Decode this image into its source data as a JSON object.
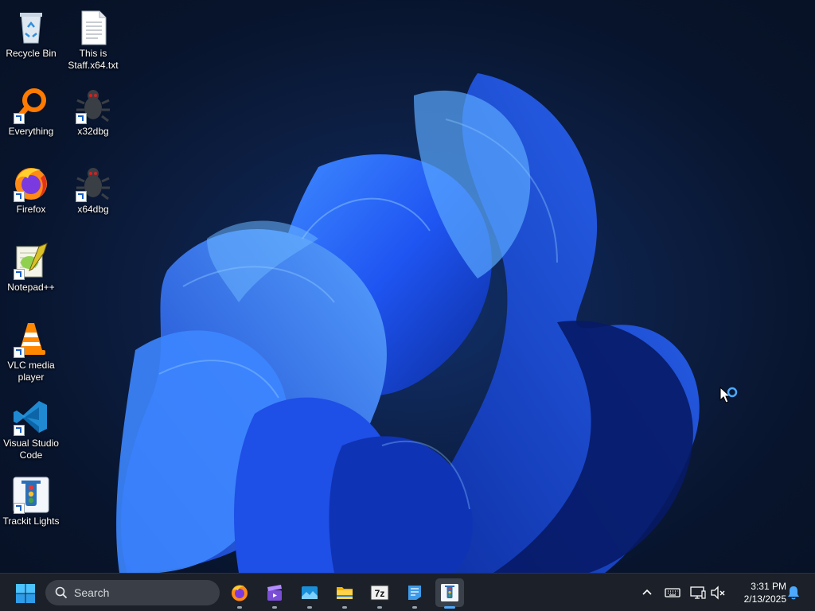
{
  "desktop": {
    "icons": [
      {
        "label": "Recycle Bin",
        "icon": "recycle-bin-icon",
        "shortcut": false
      },
      {
        "label": "This is Staff.x64.txt",
        "icon": "text-file-icon",
        "shortcut": false
      },
      {
        "label": "Everything",
        "icon": "everything-search-icon",
        "shortcut": true
      },
      {
        "label": "x32dbg",
        "icon": "x32dbg-bug-icon",
        "shortcut": true
      },
      {
        "label": "Firefox",
        "icon": "firefox-icon",
        "shortcut": true
      },
      {
        "label": "x64dbg",
        "icon": "x64dbg-bug-icon",
        "shortcut": true
      },
      {
        "label": "Notepad++",
        "icon": "notepad-plus-plus-icon",
        "shortcut": true
      },
      {
        "label": "VLC media player",
        "icon": "vlc-cone-icon",
        "shortcut": true
      },
      {
        "label": "Visual Studio Code",
        "icon": "vscode-icon",
        "shortcut": true
      },
      {
        "label": "Trackit Lights",
        "icon": "trackit-lights-icon",
        "shortcut": true
      }
    ]
  },
  "taskbar": {
    "search_placeholder": "Search",
    "pinned_apps": [
      {
        "name": "Firefox",
        "icon": "firefox-icon",
        "running": true
      },
      {
        "name": "Media app",
        "icon": "clapperboard-icon",
        "running": true
      },
      {
        "name": "Photos app",
        "icon": "photos-icon",
        "running": true
      },
      {
        "name": "File Explorer",
        "icon": "folder-icon",
        "running": true
      },
      {
        "name": "7-Zip",
        "icon": "7zip-icon",
        "running": true
      },
      {
        "name": "Notepad",
        "icon": "notepad-icon",
        "running": true
      },
      {
        "name": "Trackit Lights",
        "icon": "trackit-lights-icon",
        "running": true,
        "active": true
      }
    ],
    "tray": {
      "time": "3:31 PM",
      "date": "2/13/2025"
    }
  },
  "colors": {
    "accent": "#4ca9ff",
    "taskbar": "#1c2129",
    "wallpaper_bloom": "#1f5bff"
  }
}
